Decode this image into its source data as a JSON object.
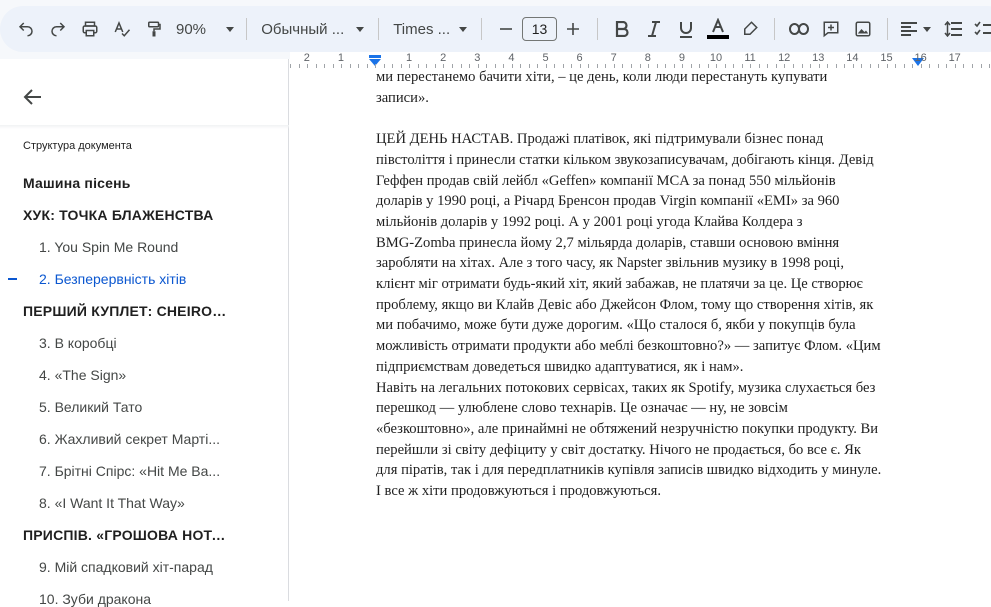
{
  "toolbar": {
    "zoom": "90%",
    "style": "Обычный ...",
    "font": "Times ...",
    "font_size": "13"
  },
  "outline": {
    "title": "Структура документа",
    "items": [
      {
        "label": "Машина пісень",
        "level": 1
      },
      {
        "label": "ХУК: ТОЧКА БЛАЖЕНСТВА",
        "level": 1
      },
      {
        "label": "1. You Spin Me Round",
        "level": 2
      },
      {
        "label": "2. Безперервність хітів",
        "level": 2,
        "active": true
      },
      {
        "label": "ПЕРШИЙ КУПЛЕТ: CHEIRON:...",
        "level": 1
      },
      {
        "label": "3. В коробці",
        "level": 2
      },
      {
        "label": "4. «The Sign»",
        "level": 2
      },
      {
        "label": "5. Великий Тато",
        "level": 2
      },
      {
        "label": "6. Жахливий секрет Марті...",
        "level": 2
      },
      {
        "label": "7. Брітні Спірс: «Hit Me Ba...",
        "level": 2
      },
      {
        "label": "8. «I Want It That Way»",
        "level": 2
      },
      {
        "label": "ПРИСПІВ. «ГРОШОВА НОТА...",
        "level": 1
      },
      {
        "label": "9. Мій спадковий хіт-парад",
        "level": 2
      },
      {
        "label": "10. Зуби дракона",
        "level": 2
      }
    ]
  },
  "ruler": {
    "labels": [
      "2",
      "1",
      "1",
      "2",
      "3",
      "4",
      "5",
      "6",
      "7",
      "8",
      "9",
      "10",
      "11",
      "12",
      "13",
      "14",
      "15",
      "16",
      "17"
    ]
  },
  "document": {
    "lines": [
      "ми перестанемо бачити хіти, – це день, коли люди перестануть купувати",
      "записи».",
      "",
      "ЦЕЙ ДЕНЬ НАСТАВ. Продажі платівок, які підтримували бізнес понад",
      "півстоліття і принесли статки кільком звукозаписувачам, добігають кінця. Девід",
      "Геффен продав свій лейбл «Geffen» компанії MCA за понад 550 мільйонів",
      "доларів у 1990 році, а Річард Бренсон продав Virgin компанії «EMI» за 960",
      "мільйонів доларів у 1992 році. А у 2001 році угода Клайва Колдера з",
      "BMG-Zomba принесла йому 2,7 мільярда доларів, ставши основою вміння",
      "заробляти на хітах. Але з того часу, як Napster звільнив музику в 1998 році,",
      "клієнт міг отримати будь-який хіт, який забажав, не платячи за це. Це створює",
      "проблему, якщо ви Клайв Девіс або Джейсон Флом, тому що створення хітів, як",
      "ми побачимо, може бути дуже дорогим. «Що сталося б, якби у покупців була",
      "можливість отримати продукти або меблі безкоштовно?» — запитує Флом. «Цим",
      "підприємствам доведеться швидко адаптуватися, як і нам».",
      "Навіть на легальних потокових сервісах, таких як Spotify, музика слухається без",
      "перешкод — улюблене слово технарів. Це означає — ну, не зовсім",
      "«безкоштовно», але принаймні не обтяжений незручністю покупки продукту. Ви",
      "перейшли зі світу дефіциту у світ достатку. Нічого не продається, бо все є. Як",
      "для піратів, так і для передплатників купівля записів швидко відходить у минуле.",
      "І все ж хіти продовжуються і продовжуються."
    ]
  },
  "colors": {
    "accent": "#0b57d0",
    "toolbar_bg": "#edf2fa"
  }
}
